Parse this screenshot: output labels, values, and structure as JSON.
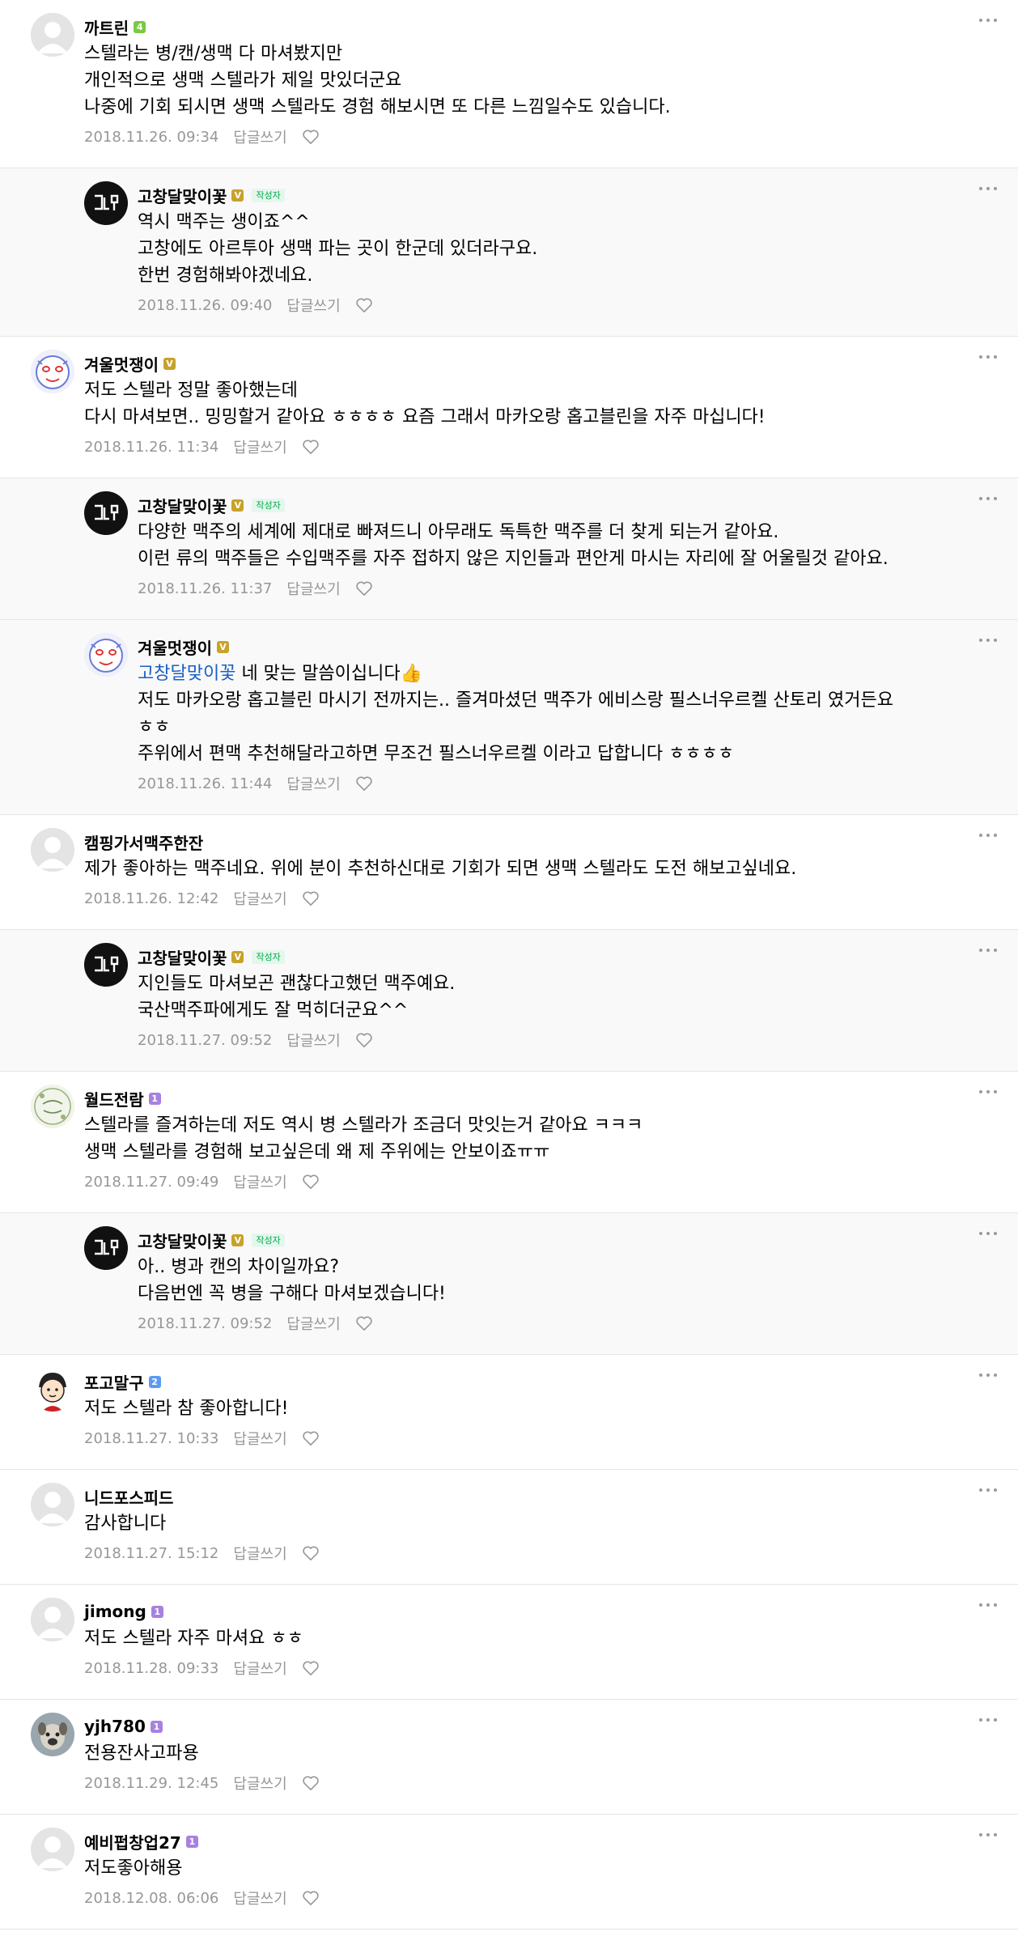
{
  "reply_label": "답글쓰기",
  "author_tag": "작성자",
  "comments": [
    {
      "id": "c1",
      "reply": false,
      "nick": "까트린",
      "badge": "4",
      "badge_color": "#7ac943",
      "avatar": "default",
      "mention": "",
      "text": "스텔라는 병/캔/생맥 다 마셔봤지만\n개인적으로 생맥 스텔라가 제일 맛있더군요\n나중에 기회 되시면 생맥 스텔라도 경험 해보시면 또 다른 느낌일수도 있습니다.",
      "date": "2018.11.26. 09:34",
      "is_author": false
    },
    {
      "id": "c2",
      "reply": true,
      "nick": "고창달맞이꽃",
      "badge": "V",
      "badge_color": "#c8a22a",
      "avatar": "blog",
      "mention": "",
      "text": "역시 맥주는 생이죠^^\n고창에도 아르투아 생맥 파는 곳이 한군데 있더라구요.\n한번 경험해봐야겠네요.",
      "date": "2018.11.26. 09:40",
      "is_author": true
    },
    {
      "id": "c3",
      "reply": false,
      "nick": "겨울멋쟁이",
      "badge": "V",
      "badge_color": "#c8a22a",
      "avatar": "face",
      "mention": "",
      "text": "저도 스텔라 정말 좋아했는데\n다시 마셔보면.. 밍밍할거 같아요 ㅎㅎㅎㅎ 요즘 그래서 마카오랑 홉고블린을 자주 마십니다!",
      "date": "2018.11.26. 11:34",
      "is_author": false
    },
    {
      "id": "c4",
      "reply": true,
      "nick": "고창달맞이꽃",
      "badge": "V",
      "badge_color": "#c8a22a",
      "avatar": "blog",
      "mention": "",
      "text": "다양한 맥주의 세계에 제대로 빠져드니 아무래도 독특한 맥주를 더 찾게 되는거 같아요.\n이런 류의 맥주들은 수입맥주를 자주 접하지 않은 지인들과 편안게 마시는 자리에 잘 어울릴것 같아요.",
      "date": "2018.11.26. 11:37",
      "is_author": true
    },
    {
      "id": "c5",
      "reply": true,
      "nick": "겨울멋쟁이",
      "badge": "V",
      "badge_color": "#c8a22a",
      "avatar": "face",
      "mention": "고창달맞이꽃",
      "text": " 네 맞는 말씀이십니다👍\n저도 마카오랑 홉고블린 마시기 전까지는.. 즐겨마셨던 맥주가 에비스랑 필스너우르켈 산토리 였거든요\nㅎㅎ\n주위에서 편맥 추천해달라고하면 무조건 필스너우르켈 이라고 답합니다 ㅎㅎㅎㅎ",
      "date": "2018.11.26. 11:44",
      "is_author": false
    },
    {
      "id": "c6",
      "reply": false,
      "nick": "캠핑가서맥주한잔",
      "badge": "",
      "badge_color": "",
      "avatar": "default",
      "mention": "",
      "text": "제가 좋아하는 맥주네요. 위에 분이 추천하신대로 기회가 되면 생맥 스텔라도 도전 해보고싶네요.",
      "date": "2018.11.26. 12:42",
      "is_author": false
    },
    {
      "id": "c7",
      "reply": true,
      "nick": "고창달맞이꽃",
      "badge": "V",
      "badge_color": "#c8a22a",
      "avatar": "blog",
      "mention": "",
      "text": "지인들도 마셔보곤 괜찮다고했던 맥주예요.\n국산맥주파에게도 잘 먹히더군요^^",
      "date": "2018.11.27. 09:52",
      "is_author": true
    },
    {
      "id": "c8",
      "reply": false,
      "nick": "월드전람",
      "badge": "1",
      "badge_color": "#a781e0",
      "avatar": "nature",
      "mention": "",
      "text": "스텔라를 즐겨하는데 저도 역시 병 스텔라가 조금더 맛잇는거 같아요 ㅋㅋㅋ\n생맥 스텔라를 경험해 보고싶은데 왜 제 주위에는 안보이죠ㅠㅠ",
      "date": "2018.11.27. 09:49",
      "is_author": false
    },
    {
      "id": "c9",
      "reply": true,
      "nick": "고창달맞이꽃",
      "badge": "V",
      "badge_color": "#c8a22a",
      "avatar": "blog",
      "mention": "",
      "text": "아.. 병과 캔의 차이일까요?\n다음번엔 꼭 병을 구해다 마셔보겠습니다!",
      "date": "2018.11.27. 09:52",
      "is_author": true
    },
    {
      "id": "c10",
      "reply": false,
      "nick": "포고말구",
      "badge": "2",
      "badge_color": "#5b9bf2",
      "avatar": "cartoon",
      "mention": "",
      "text": "저도 스텔라 참 좋아합니다!",
      "date": "2018.11.27. 10:33",
      "is_author": false
    },
    {
      "id": "c11",
      "reply": false,
      "nick": "니드포스피드",
      "badge": "",
      "badge_color": "",
      "avatar": "default",
      "mention": "",
      "text": "감사합니다",
      "date": "2018.11.27. 15:12",
      "is_author": false
    },
    {
      "id": "c12",
      "reply": false,
      "nick": "jimong",
      "badge": "1",
      "badge_color": "#a781e0",
      "avatar": "default",
      "mention": "",
      "text": "저도 스텔라 자주 마셔요 ㅎㅎ",
      "date": "2018.11.28. 09:33",
      "is_author": false
    },
    {
      "id": "c13",
      "reply": false,
      "nick": "yjh780",
      "badge": "1",
      "badge_color": "#a781e0",
      "avatar": "dog",
      "mention": "",
      "text": "전용잔사고파용",
      "date": "2018.11.29. 12:45",
      "is_author": false
    },
    {
      "id": "c14",
      "reply": false,
      "nick": "예비펍창업27",
      "badge": "1",
      "badge_color": "#a781e0",
      "avatar": "default",
      "mention": "",
      "text": "저도좋아해용",
      "date": "2018.12.08. 06:06",
      "is_author": false
    }
  ]
}
